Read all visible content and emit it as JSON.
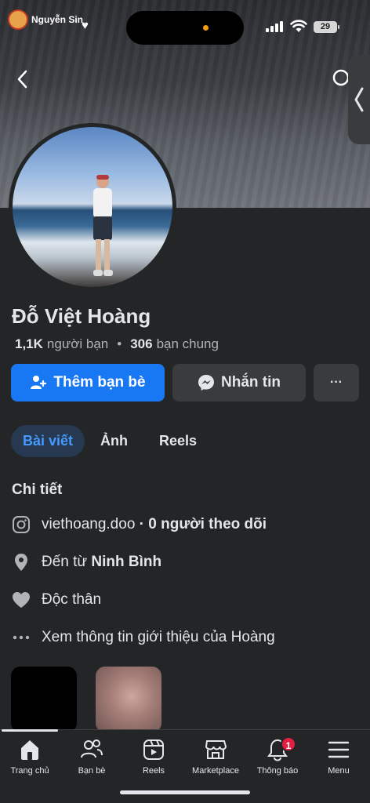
{
  "watermark": {
    "title": "Nguyễn Sin"
  },
  "status_bar": {
    "battery": "29"
  },
  "profile": {
    "name": "Đỗ Việt Hoàng",
    "friends_count": "1,1K",
    "friends_label": "người bạn",
    "separator": "•",
    "mutual_count": "306",
    "mutual_label": "bạn chung"
  },
  "actions": {
    "add_friend": "Thêm bạn bè",
    "message": "Nhắn tin",
    "more": "···"
  },
  "tabs": [
    {
      "label": "Bài viết",
      "active": true
    },
    {
      "label": "Ảnh",
      "active": false
    },
    {
      "label": "Reels",
      "active": false
    }
  ],
  "details": {
    "title": "Chi tiết",
    "instagram_handle": "viethoang.doo",
    "instagram_followers": "· 0 người theo dõi",
    "hometown_prefix": "Đến từ",
    "hometown": "Ninh Bình",
    "relationship": "Độc thân",
    "see_more": "Xem thông tin giới thiệu của Hoàng"
  },
  "bottom_nav": [
    {
      "label": "Trang chủ",
      "icon": "home-icon",
      "active": true
    },
    {
      "label": "Bạn bè",
      "icon": "friends-icon"
    },
    {
      "label": "Reels",
      "icon": "reels-icon"
    },
    {
      "label": "Marketplace",
      "icon": "marketplace-icon"
    },
    {
      "label": "Thông báo",
      "icon": "bell-icon",
      "badge": "1"
    },
    {
      "label": "Menu",
      "icon": "menu-icon"
    }
  ],
  "colors": {
    "primary": "#1877f2",
    "background": "#242526",
    "active_tab_text": "#4599ff",
    "badge": "#e41e3f"
  }
}
